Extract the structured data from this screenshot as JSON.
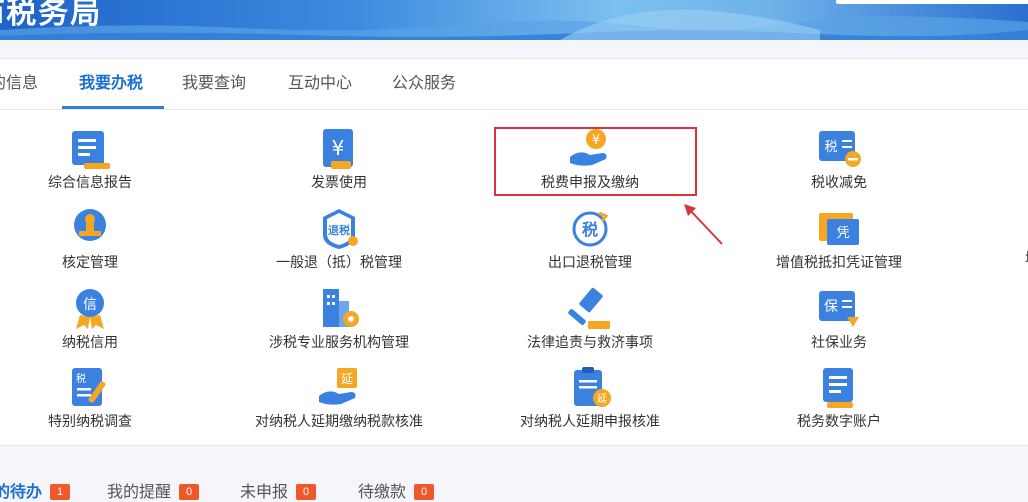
{
  "banner": {
    "title": "ī税务局"
  },
  "nav": {
    "items": [
      {
        "label": "的信息"
      },
      {
        "label": "我要办税"
      },
      {
        "label": "我要查询"
      },
      {
        "label": "互动中心"
      },
      {
        "label": "公众服务"
      }
    ]
  },
  "grid": {
    "items": [
      {
        "label": "综合信息报告",
        "icon": "report-icon"
      },
      {
        "label": "发票使用",
        "icon": "invoice-yen-icon"
      },
      {
        "label": "税费申报及缴纳",
        "icon": "hand-coin-icon"
      },
      {
        "label": "税收减免",
        "icon": "tax-reduction-icon"
      },
      {
        "label": "核定管理",
        "icon": "stamp-icon"
      },
      {
        "label": "一般退（抵）税管理",
        "icon": "refund-icon"
      },
      {
        "label": "出口退税管理",
        "icon": "export-refund-icon"
      },
      {
        "label": "增值税抵扣凭证管理",
        "icon": "voucher-icon"
      },
      {
        "label": "纳税信用",
        "icon": "credit-medal-icon"
      },
      {
        "label": "涉税专业服务机构管理",
        "icon": "building-gear-icon"
      },
      {
        "label": "法律追责与救济事项",
        "icon": "gavel-icon"
      },
      {
        "label": "社保业务",
        "icon": "social-security-icon"
      },
      {
        "label": "特别纳税调查",
        "icon": "special-tax-icon"
      },
      {
        "label": "对纳税人延期缴纳税款核准",
        "icon": "deferred-payment-icon"
      },
      {
        "label": "对纳税人延期申报核准",
        "icon": "deferred-declaration-icon"
      },
      {
        "label": "税务数字账户",
        "icon": "digital-account-icon"
      }
    ],
    "edge_labels": [
      "增"
    ]
  },
  "icon_text": {
    "yen": "¥",
    "refund": "退税",
    "export": "税",
    "voucher": "凭",
    "credit": "信",
    "social": "保",
    "special": "税",
    "defer": "延",
    "tax": "税"
  },
  "tasks": {
    "tabs": [
      {
        "label": "的待办",
        "count": "1"
      },
      {
        "label": "我的提醒",
        "count": "0"
      },
      {
        "label": "未申报",
        "count": "0"
      },
      {
        "label": "待缴款",
        "count": "0"
      }
    ]
  },
  "colors": {
    "accent": "#1d6fd1",
    "highlight": "#d9353a",
    "icon_blue": "#3b82e0",
    "icon_orange": "#f5a623",
    "badge": "#f0572a"
  }
}
